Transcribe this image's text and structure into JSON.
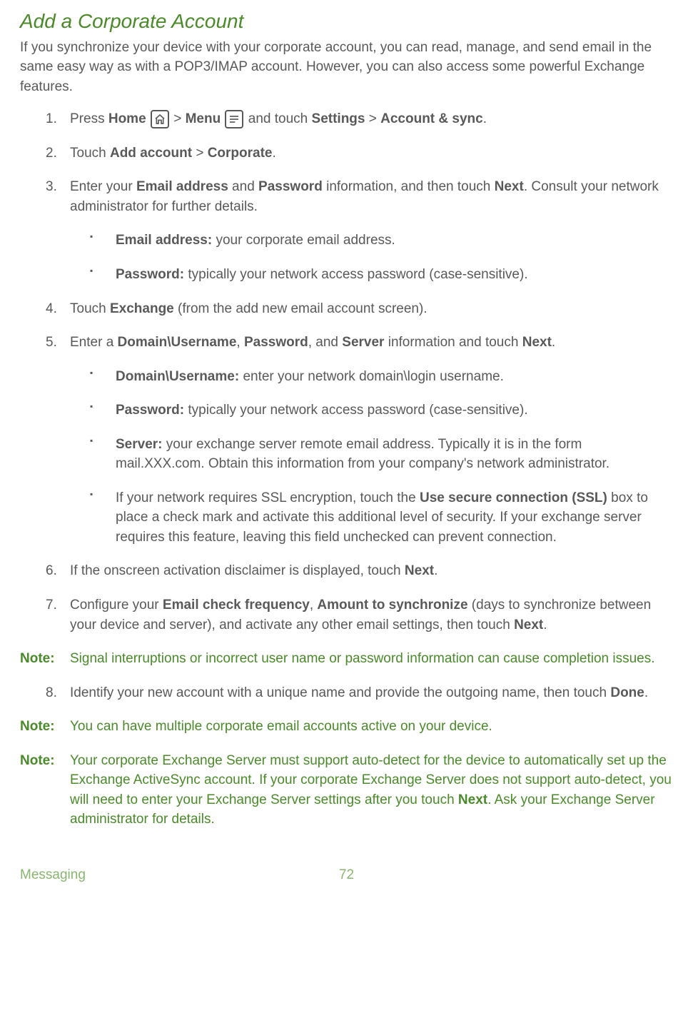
{
  "title": "Add a Corporate Account",
  "intro": "If you synchronize your device with your corporate account, you can read, manage, and send email in the same easy way as with a POP3/IMAP account. However, you can also access some powerful Exchange features.",
  "steps": {
    "s1": {
      "num": "1.",
      "t1": "Press ",
      "b1": "Home",
      "t2": " > ",
      "b2": "Menu",
      "t3": " and touch ",
      "b3": "Settings",
      "t4": " > ",
      "b4": "Account & sync",
      "t5": "."
    },
    "s2": {
      "num": "2.",
      "t1": "Touch ",
      "b1": "Add account",
      "t2": " > ",
      "b2": "Corporate",
      "t3": "."
    },
    "s3": {
      "num": "3.",
      "t1": "Enter your ",
      "b1": "Email address",
      "t2": " and ",
      "b2": "Password",
      "t3": " information, and then touch ",
      "b3": "Next",
      "t4": ". Consult your network administrator for further details.",
      "sub": {
        "a": {
          "b": "Email address:",
          "t": " your corporate email address."
        },
        "b": {
          "b": "Password:",
          "t": " typically your network access password (case-sensitive)."
        }
      }
    },
    "s4": {
      "num": "4.",
      "t1": "Touch ",
      "b1": "Exchange",
      "t2": " (from the add new email account screen)."
    },
    "s5": {
      "num": "5.",
      "t1": "Enter a ",
      "b1": "Domain\\Username",
      "t2": ", ",
      "b2": "Password",
      "t3": ", and ",
      "b3": "Server",
      "t4": " information and touch ",
      "b4": "Next",
      "t5": ".",
      "sub": {
        "a": {
          "b": "Domain\\Username:",
          "t": " enter your network domain\\login username."
        },
        "b": {
          "b": "Password:",
          "t": " typically your network access password (case-sensitive)."
        },
        "c": {
          "b": "Server:",
          "t": " your exchange server remote email address. Typically it is in the form mail.XXX.com. Obtain this information from your company's network administrator."
        },
        "d": {
          "t1": "If your network requires SSL encryption, touch the ",
          "b1": "Use secure connection (SSL)",
          "t2": " box to place a check mark and activate this additional level of security. If your exchange server requires this feature, leaving this field unchecked can prevent connection."
        }
      }
    },
    "s6": {
      "num": "6.",
      "t1": "If the onscreen activation disclaimer is displayed, touch ",
      "b1": "Next",
      "t2": "."
    },
    "s7": {
      "num": "7.",
      "t1": "Configure your ",
      "b1": "Email check frequency",
      "t2": ", ",
      "b2": "Amount to synchronize",
      "t3": " (days to synchronize between your device and server), and activate any other email settings, then touch ",
      "b3": "Next",
      "t4": "."
    },
    "s8": {
      "num": "8.",
      "t1": "Identify your new account with a unique name and provide the outgoing name, then touch ",
      "b1": "Done",
      "t2": "."
    }
  },
  "notes": {
    "label": "Note:",
    "n1": "Signal interruptions or incorrect user name or password information can cause completion issues.",
    "n2": "You can have multiple corporate email accounts active on your device.",
    "n3": {
      "t1": "Your corporate Exchange Server must support auto-detect for the device to automatically set up the Exchange ActiveSync account. If your corporate Exchange Server does not support auto-detect, you will need to enter your Exchange Server settings after you touch ",
      "b1": "Next",
      "t2": ". Ask your Exchange Server administrator for details."
    }
  },
  "footer": {
    "section": "Messaging",
    "page": "72"
  }
}
